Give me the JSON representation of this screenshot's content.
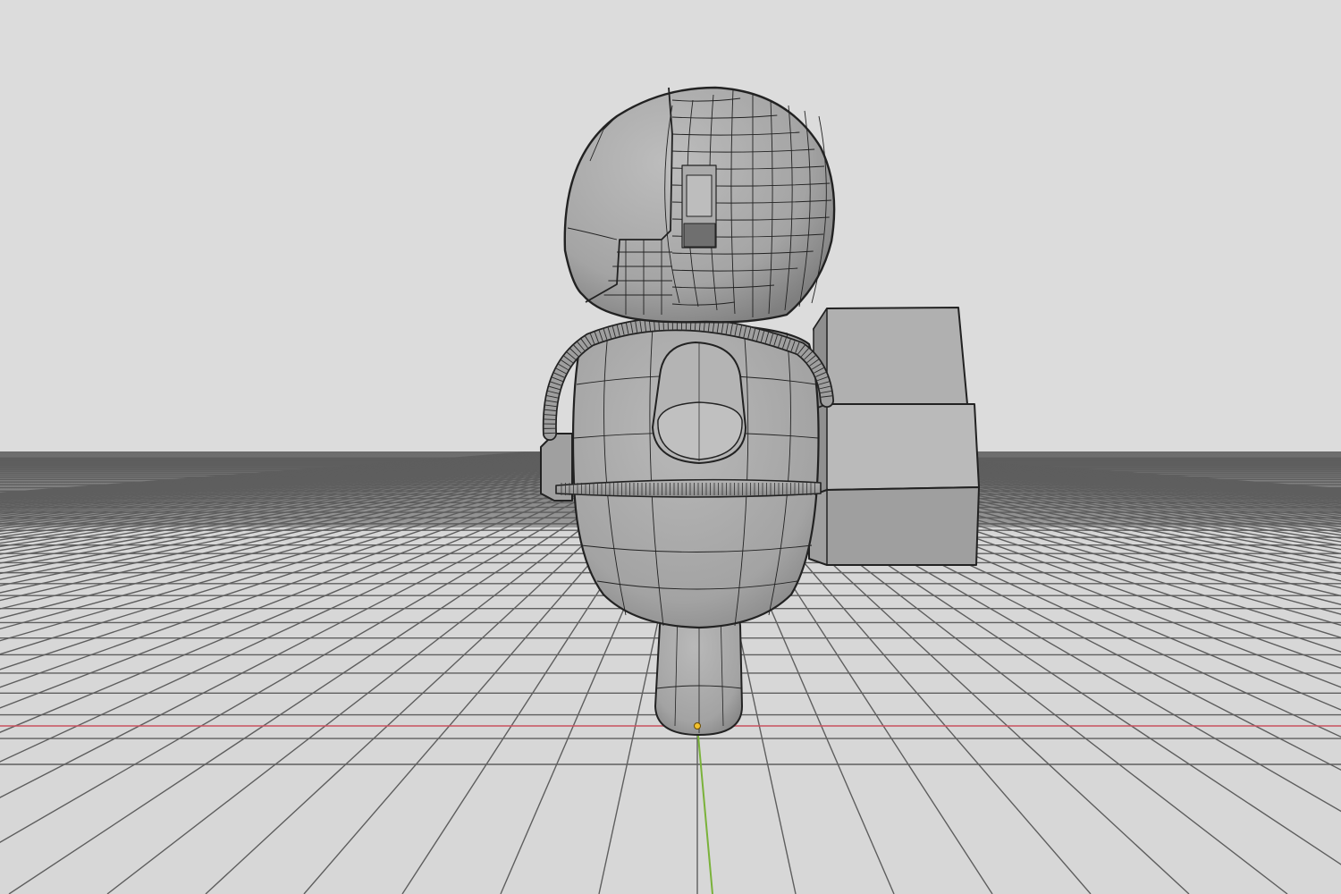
{
  "viewport": {
    "mode": "3d-viewport-wireframe-overlay",
    "colors": {
      "background": "#dcdcdc",
      "floor": "#d8d8d8",
      "grid_line": "#5c5c5c",
      "x_axis": "#c8505e",
      "y_axis": "#7ab23a",
      "model_fill": "#a6a6a6",
      "model_edge": "#222222",
      "origin_dot": "#f2c12e"
    }
  }
}
